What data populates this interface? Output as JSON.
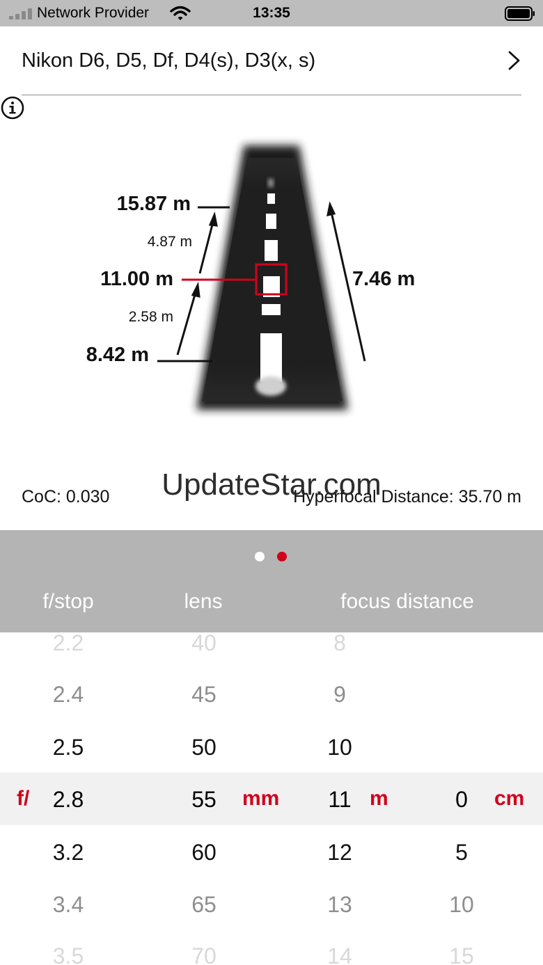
{
  "status_bar": {
    "provider": "Network Provider",
    "time": "13:35",
    "icons": [
      "signal-icon",
      "wifi-icon",
      "battery-icon"
    ]
  },
  "camera": {
    "title": "Nikon D6, D5, Df, D4(s), D3(x, s)",
    "chevron_icon": "chevron-right-icon"
  },
  "diagram": {
    "far_limit": "15.87 m",
    "focus_distance": "11.00 m",
    "near_limit": "8.42 m",
    "upper_diff": "4.87 m",
    "lower_diff": "2.58 m",
    "total_depth": "7.46 m",
    "info_icon": "info-icon"
  },
  "stats": {
    "coc": "CoC: 0.030",
    "hyperfocal": "Hyperfocal Distance: 35.70 m"
  },
  "watermark": "UpdateStar.com",
  "pager": {
    "pages": 2,
    "active": 2
  },
  "columns": {
    "fstop": "f/stop",
    "lens": "lens",
    "focus": "focus distance"
  },
  "units": {
    "fstop": "f/",
    "lens": "mm",
    "meters": "m",
    "centimeters": "cm"
  },
  "wheels": {
    "fstop": [
      "2.2",
      "2.4",
      "2.5",
      "2.8",
      "3.2",
      "3.4",
      "3.5"
    ],
    "lens": [
      "40",
      "45",
      "50",
      "55",
      "60",
      "65",
      "70"
    ],
    "meters": [
      "8",
      "9",
      "10",
      "11",
      "12",
      "13",
      "14"
    ],
    "centimeters": [
      "",
      "",
      "",
      "0",
      "5",
      "10",
      "15"
    ]
  },
  "selected": {
    "fstop": "2.8",
    "lens": "55",
    "meters": "11",
    "centimeters": "0"
  },
  "colors": {
    "accent": "#d0021b",
    "header_gray": "#b4b4b4",
    "status_gray": "#bdbdbd"
  }
}
